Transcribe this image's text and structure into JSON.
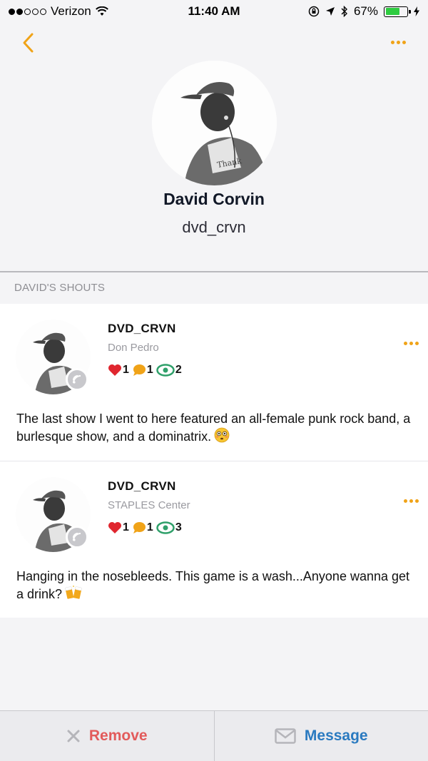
{
  "status_bar": {
    "carrier": "Verizon",
    "time": "11:40 AM",
    "battery_percent": "67%",
    "battery_level": 0.67,
    "signal_bars": 2
  },
  "nav": {
    "back_icon": "chevron-left-icon",
    "more_icon": "more-dots-icon",
    "accent": "#f0a318"
  },
  "profile": {
    "name": "David Corvin",
    "handle": "dvd_crvn"
  },
  "section": {
    "label": "DAVID'S SHOUTS"
  },
  "shouts": [
    {
      "user": "DVD_CRVN",
      "location": "Don Pedro",
      "likes": "1",
      "comments": "1",
      "views": "2",
      "text": "The last show I went to here featured an all-female punk rock band, a burlesque show, and a dominatrix.",
      "emoji": "flushed-face-icon"
    },
    {
      "user": "DVD_CRVN",
      "location": "STAPLES Center",
      "likes": "1",
      "comments": "1",
      "views": "3",
      "text": "Hanging in the nosebleeds. This game is a wash...Anyone wanna get a drink?",
      "emoji": "beer-mugs-icon"
    }
  ],
  "bottom_bar": {
    "remove_label": "Remove",
    "message_label": "Message",
    "remove_color": "#e25b5b",
    "message_color": "#2a7ac0"
  }
}
